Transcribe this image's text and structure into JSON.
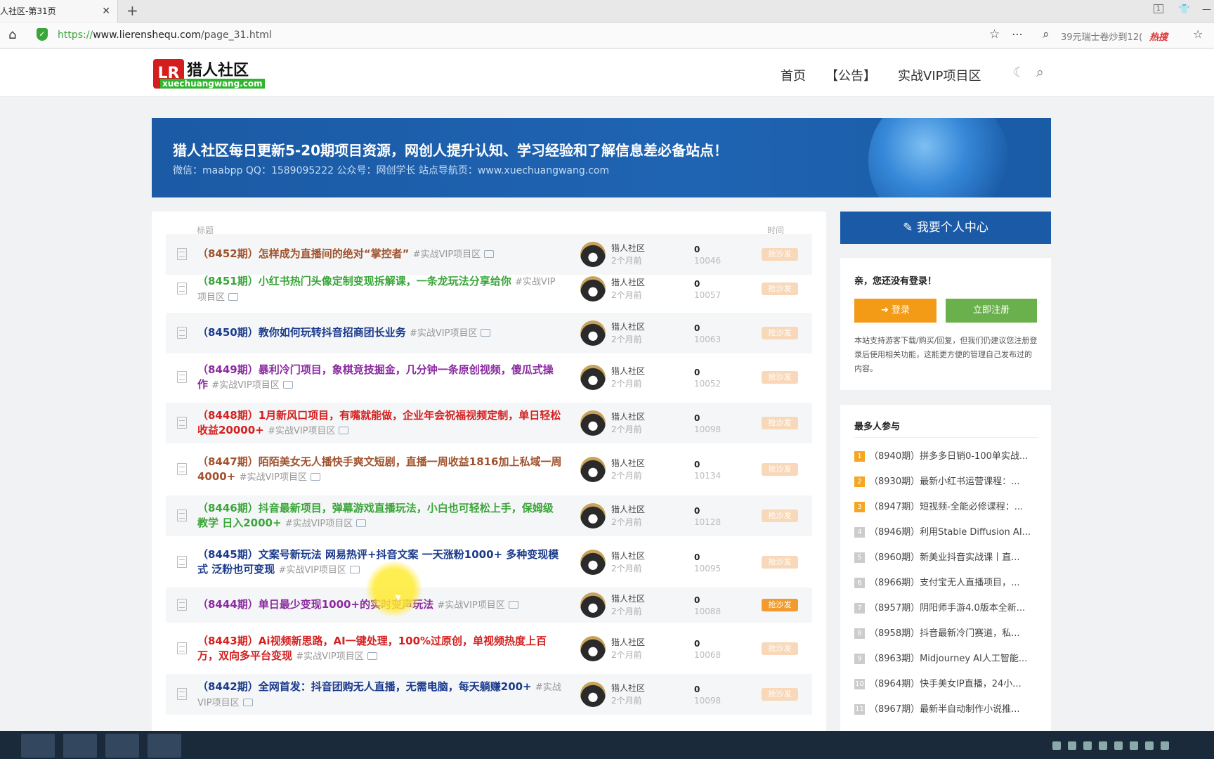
{
  "browser": {
    "tab_title": "人社区-第31页",
    "url_protocol": "https://",
    "url_domain": "www.lierenshequ.com",
    "url_path": "/page_31.html",
    "search_hint": "39元瑞士卷炒到12(",
    "hot_label": "热搜",
    "tab_count": "1"
  },
  "site": {
    "logo_mark": "LR",
    "logo_name": "猎人社区",
    "logo_sub": "xuechuangwang.com",
    "nav": [
      "首页",
      "【公告】",
      "实战VIP项目区"
    ]
  },
  "banner": {
    "headline": "猎人社区每日更新5-20期项目资源，网创人提升认知、学习经验和了解信息差必备站点！",
    "contact": "微信：maabpp QQ：1589095222 公众号：网创学长 站点导航页：www.xuechuangwang.com"
  },
  "list": {
    "col_title": "标题",
    "col_time": "时间",
    "rows": [
      {
        "title": "（8452期）怎样成为直播间的绝对“掌控者”",
        "tag": "#实战VIP项目区",
        "color": "#a0522d",
        "author": "猎人社区",
        "ago": "2个月前",
        "comments": "0",
        "views": "10046",
        "badge": "抢沙发"
      },
      {
        "title": "（8451期）小红书热门头像定制变现拆解课，一条龙玩法分享给你",
        "tag": "#实战VIP项目区",
        "color": "#3aa53a",
        "author": "猎人社区",
        "ago": "2个月前",
        "comments": "0",
        "views": "10057",
        "badge": "抢沙发"
      },
      {
        "title": "（8450期）教你如何玩转抖音招商团长业务",
        "tag": "#实战VIP项目区",
        "color": "#1a3a8c",
        "author": "猎人社区",
        "ago": "2个月前",
        "comments": "0",
        "views": "10063",
        "badge": "抢沙发"
      },
      {
        "title": "（8449期）暴利冷门项目，象棋竞技掘金，几分钟一条原创视频，傻瓜式操作",
        "tag": "#实战VIP项目区",
        "color": "#8b2aa0",
        "author": "猎人社区",
        "ago": "2个月前",
        "comments": "0",
        "views": "10052",
        "badge": "抢沙发"
      },
      {
        "title": "（8448期）1月新风口项目，有嘴就能做，企业年会祝福视频定制，单日轻松收益20000+",
        "tag": "#实战VIP项目区",
        "color": "#d42020",
        "author": "猎人社区",
        "ago": "2个月前",
        "comments": "0",
        "views": "10098",
        "badge": "抢沙发"
      },
      {
        "title": "（8447期）陌陌美女无人播快手爽文短剧，直播一周收益1816加上私域一周4000+",
        "tag": "#实战VIP项目区",
        "color": "#a0522d",
        "author": "猎人社区",
        "ago": "2个月前",
        "comments": "0",
        "views": "10134",
        "badge": "抢沙发"
      },
      {
        "title": "（8446期）抖音最新项目，弹幕游戏直播玩法，小白也可轻松上手，保姆级教学 日入2000+",
        "tag": "#实战VIP项目区",
        "color": "#3aa53a",
        "author": "猎人社区",
        "ago": "2个月前",
        "comments": "0",
        "views": "10128",
        "badge": "抢沙发"
      },
      {
        "title": "（8445期）文案号新玩法 网易热评+抖音文案 一天涨粉1000+ 多种变现模式 泛粉也可变现",
        "tag": "#实战VIP项目区",
        "color": "#1a3a8c",
        "author": "猎人社区",
        "ago": "2个月前",
        "comments": "0",
        "views": "10095",
        "badge": "抢沙发"
      },
      {
        "title": "（8444期）单日最少变现1000+的实时变声玩法",
        "tag": "#实战VIP项目区",
        "color": "#8b2aa0",
        "author": "猎人社区",
        "ago": "2个月前",
        "comments": "0",
        "views": "10088",
        "badge": "抢沙发"
      },
      {
        "title": "（8443期）Ai视频新思路，AI一键处理，100%过原创，单视频热度上百万，双向多平台变现",
        "tag": "#实战VIP项目区",
        "color": "#d42020",
        "author": "猎人社区",
        "ago": "2个月前",
        "comments": "0",
        "views": "10068",
        "badge": "抢沙发"
      },
      {
        "title": "（8442期）全网首发：抖音团购无人直播，无需电脑，每天躺赚200+",
        "tag": "#实战VIP项目区",
        "color": "#1a3a8c",
        "author": "猎人社区",
        "ago": "2个月前",
        "comments": "0",
        "views": "10098",
        "badge": "抢沙发"
      }
    ]
  },
  "sidebar": {
    "user_center": "我要个人中心",
    "login_title": "亲，您还没有登录！",
    "login_btn": "登录",
    "register_btn": "立即注册",
    "login_desc": "本站支持游客下载/购买/回复，但我们仍建议您注册登录后使用相关功能，这能更方便的管理自己发布过的内容。",
    "hot_title": "最多人参与",
    "hot_items": [
      {
        "n": "1",
        "text": "（8940期）拼多多日销0-100单实战..."
      },
      {
        "n": "2",
        "text": "（8930期）最新小红书运营课程：..."
      },
      {
        "n": "3",
        "text": "（8947期）短视频-全能必修课程：..."
      },
      {
        "n": "4",
        "text": "（8946期）利用Stable Diffusion AI..."
      },
      {
        "n": "5",
        "text": "（8960期）新美业抖音实战课丨直..."
      },
      {
        "n": "6",
        "text": "（8966期）支付宝无人直播项目，..."
      },
      {
        "n": "7",
        "text": "（8957期）阴阳师手游4.0版本全新..."
      },
      {
        "n": "8",
        "text": "（8958期）抖音最新冷门赛道，私..."
      },
      {
        "n": "9",
        "text": "（8963期）Midjourney AI人工智能..."
      },
      {
        "n": "10",
        "text": "（8964期）快手美女IP直播，24小..."
      },
      {
        "n": "11",
        "text": "（8967期）最新半自动制作小说推..."
      }
    ]
  }
}
